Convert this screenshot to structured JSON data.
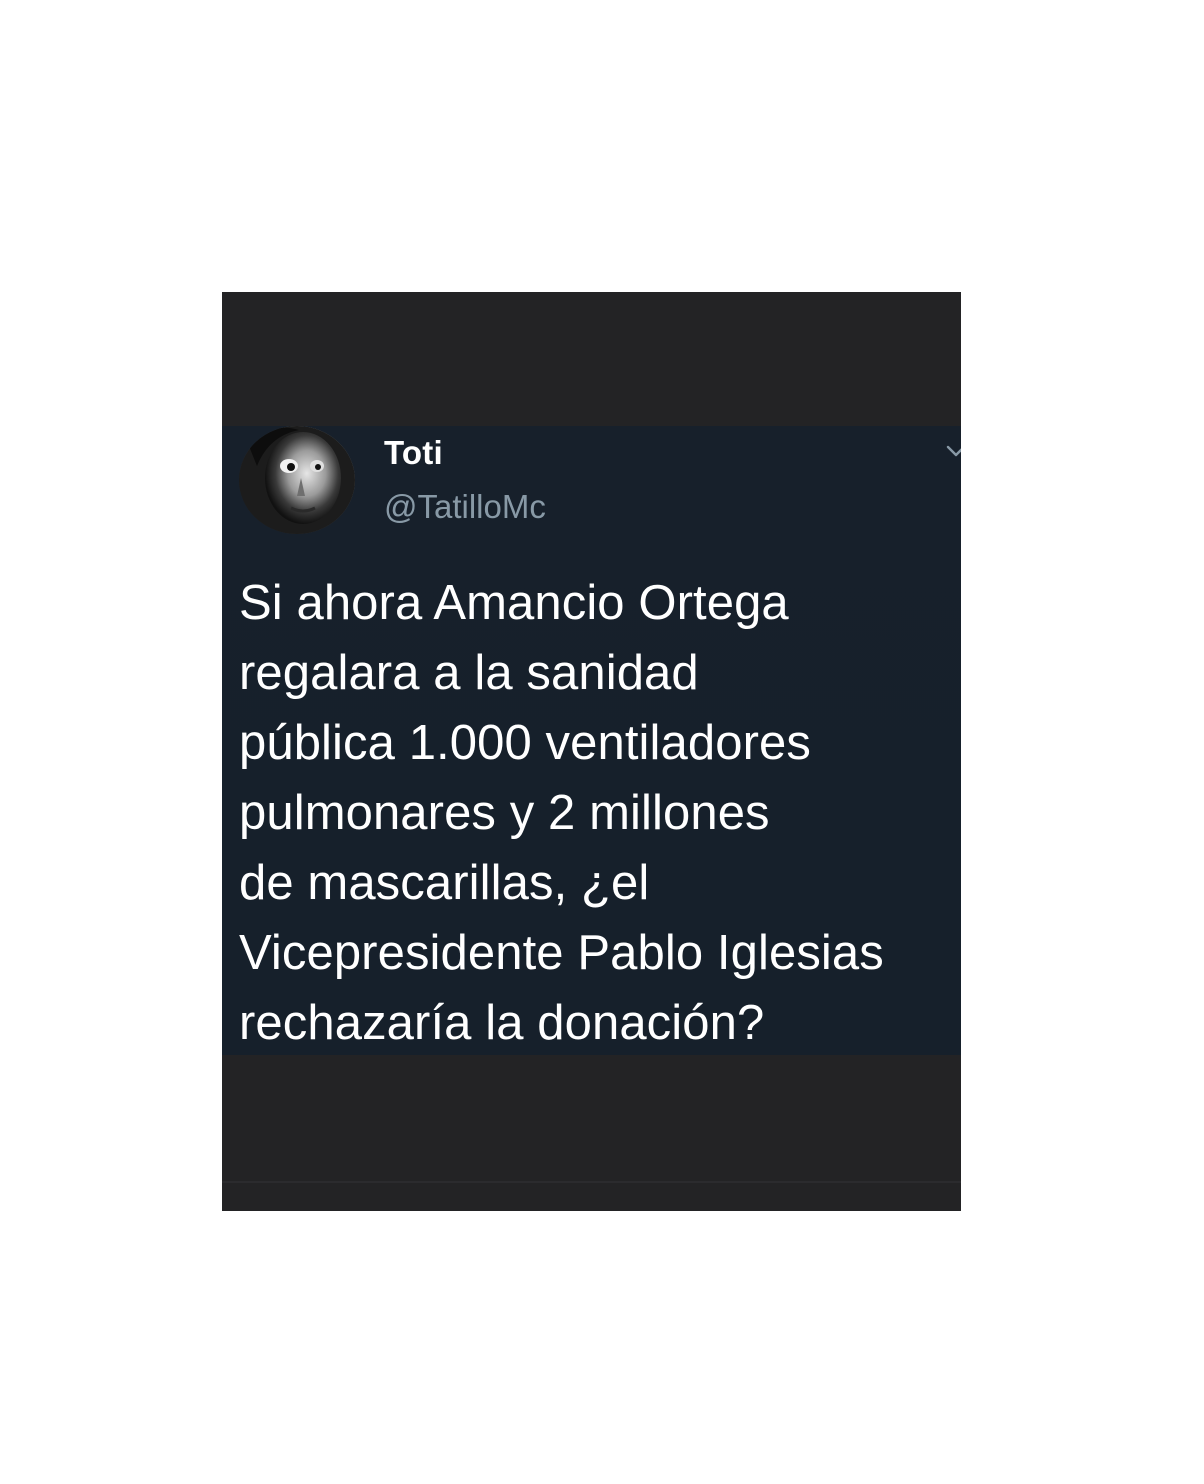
{
  "tweet": {
    "display_name": "Toti",
    "handle": "@TatilloMc",
    "text": "Si ahora Amancio Ortega\nregalara a la sanidad\npública 1.000 ventiladores\npulmonares y 2 millones\nde mascarillas, ¿el\nVicepresidente Pablo Iglesias\nrechazaría la donación?"
  },
  "icons": {
    "menu_caret": "chevron-down-icon",
    "avatar": "avatar"
  },
  "colors": {
    "frame_background": "#232325",
    "tweet_background": "#15202b",
    "text_primary": "#ffffff",
    "text_secondary": "#8899a6"
  }
}
